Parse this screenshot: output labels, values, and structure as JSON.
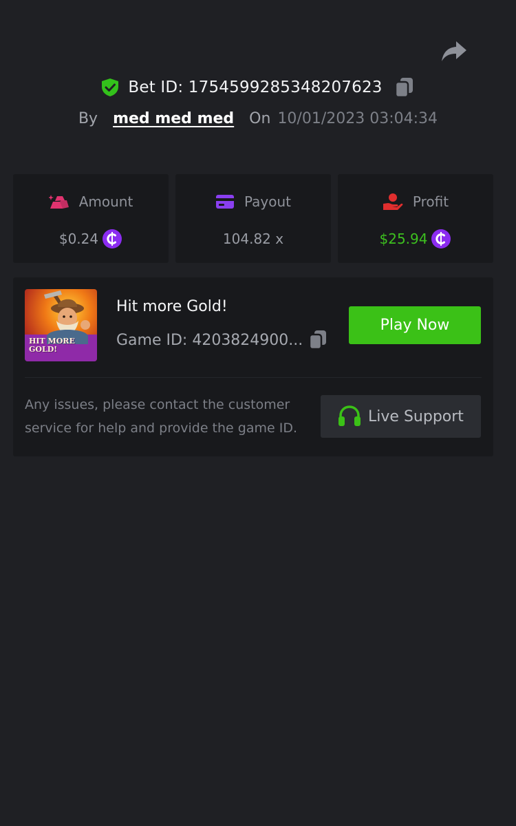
{
  "header": {
    "bet_id": "Bet ID: 1754599285348207623",
    "by_label": "By",
    "username": "med med med",
    "on_label": "On",
    "datetime": "10/01/2023 03:04:34"
  },
  "stats": [
    {
      "label": "Amount",
      "value": "$0.24",
      "icon": "gold-bars-icon",
      "icon_color": "#e0336f",
      "has_coin": true
    },
    {
      "label": "Payout",
      "value": "104.82 x",
      "icon": "card-icon",
      "icon_color": "#8a3ff0",
      "has_coin": false
    },
    {
      "label": "Profit",
      "value": "$25.94",
      "icon": "coin-hand-icon",
      "icon_color": "#e02e2e",
      "value_color": "#3dc01f",
      "has_coin": true
    }
  ],
  "game": {
    "thumbnail_title": "HIT MORE GOLD!",
    "name": "Hit more Gold!",
    "game_id": "Game ID: 4203824900...",
    "play_label": "Play Now"
  },
  "support": {
    "note": "Any issues, please contact the customer service for help and provide the game ID.",
    "button_label": "Live Support"
  },
  "colors": {
    "background": "#1f2024",
    "card": "#18191c",
    "accent_green": "#3bc117",
    "coin_purple": "#8b2cf0"
  }
}
